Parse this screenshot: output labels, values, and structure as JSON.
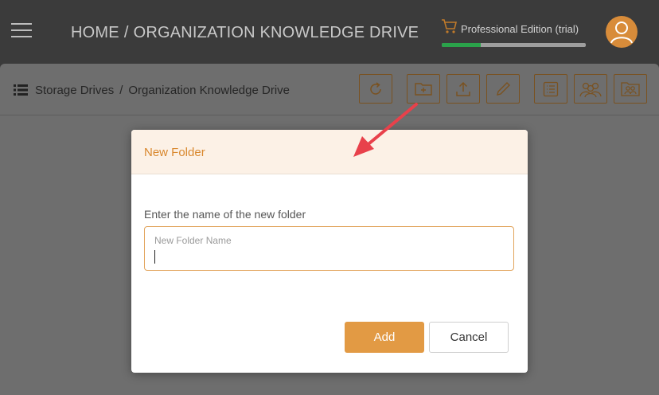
{
  "header": {
    "home": "HOME",
    "separator": "/",
    "section": "ORGANIZATION KNOWLEDGE DRIVE",
    "edition_label": "Professional Edition (trial)",
    "trial_progress_percent": 27
  },
  "breadcrumb": {
    "root": "Storage Drives",
    "separator": "/",
    "current": "Organization Knowledge Drive"
  },
  "toolbar": {
    "icons": [
      "refresh-icon",
      "new-folder-icon",
      "upload-icon",
      "rename-icon",
      "details-icon",
      "users-icon",
      "share-icon"
    ]
  },
  "dialog": {
    "title": "New Folder",
    "field_label": "Enter the name of the new folder",
    "input_value": "",
    "input_placeholder": "New Folder Name",
    "add_label": "Add",
    "cancel_label": "Cancel"
  },
  "colors": {
    "accent": "#e29a44",
    "title": "#d9882e",
    "progress": "#2aa24a",
    "annotation_arrow": "#e8414b"
  }
}
